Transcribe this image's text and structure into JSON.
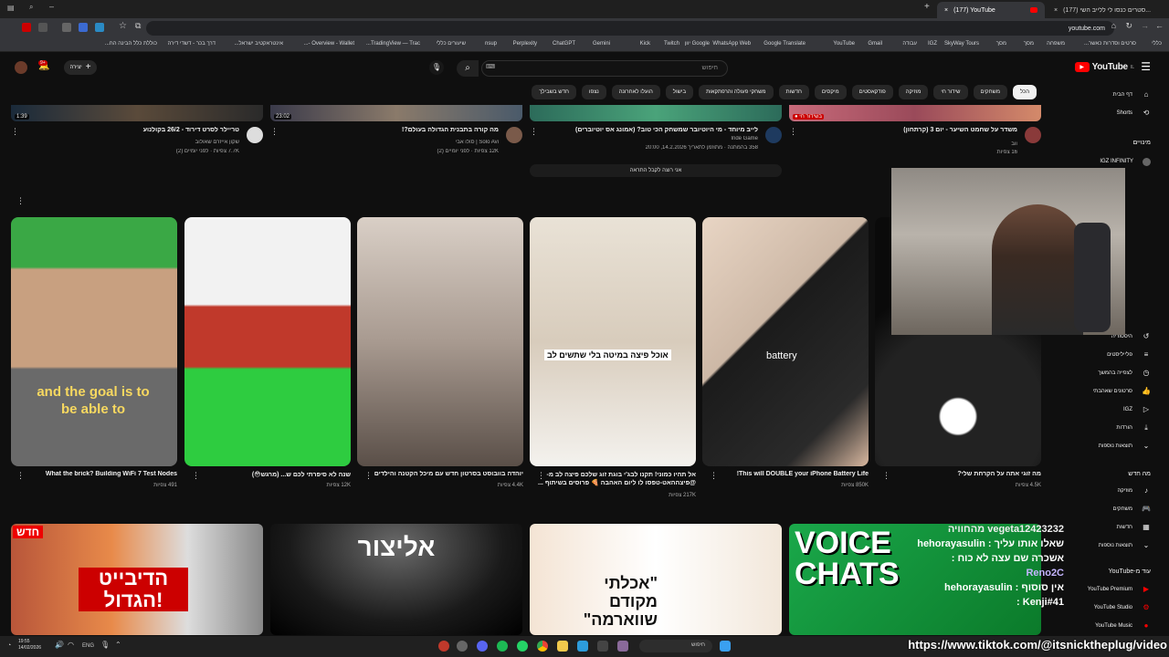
{
  "browser": {
    "tabs": [
      {
        "label": "(177) YouTube",
        "active": true
      },
      {
        "label": "(177) סטרים כנסו לי ללייב השי...",
        "active": false
      }
    ],
    "url": "youtube.com",
    "bookmarks": [
      "כללי",
      "סרטים וסדרות כאשר...",
      "משפחה",
      "מסך",
      "מסך",
      "SkyWay Tours",
      "IGZ",
      "עבודה",
      "Gmail",
      "YouTube",
      "Google Translate",
      "WhatsApp Web",
      "Google יוון",
      "Twitch",
      "Kick",
      "Gemini",
      "ChatGPT",
      "Perplexity",
      "nsup",
      "שיעורים כללי",
      "TradingView — Trac...",
      "Overview - Wallet -...",
      "אינטראקטיב ישראל...",
      "דרך בכר - דשדי דירה",
      "כוללת כלל הבינה הח..."
    ]
  },
  "youtube": {
    "logo_text": "YouTube",
    "logo_sup": "IL",
    "search_placeholder": "חיפוש",
    "create_label": "יצירה",
    "notif_count": "9+",
    "chips": [
      "הכל",
      "משחקים",
      "שידור חי",
      "מוזיקה",
      "פודקאסטים",
      "מיקסים",
      "חדשות",
      "משחקי פעולה והרפתקאות",
      "בישול",
      "הועלו לאחרונה",
      "נצפו",
      "חדש בשבילך"
    ]
  },
  "sidebar": {
    "items": [
      {
        "label": "דף הבית",
        "icon": "home-icon"
      },
      {
        "label": "Shorts",
        "icon": "shorts-icon"
      }
    ],
    "subs_header": "מינויים",
    "subs": [
      {
        "label": "IGZ INFINITY"
      }
    ],
    "you_items": [
      {
        "label": "היסטוריה",
        "icon": "history-icon"
      },
      {
        "label": "פלייליסטים",
        "icon": "playlist-icon"
      },
      {
        "label": "לצפייה בהמשך",
        "icon": "clock-icon"
      },
      {
        "label": "סרטונים שאהבתי",
        "icon": "like-icon"
      },
      {
        "label": "IGZ",
        "icon": "video-icon"
      },
      {
        "label": "הורדות",
        "icon": "download-icon"
      },
      {
        "label": "תוצאות נוספות",
        "icon": "chevron-down-icon"
      }
    ],
    "explore_header": "מה חדש",
    "explore": [
      {
        "label": "מוזיקה",
        "icon": "music-icon"
      },
      {
        "label": "משחקים",
        "icon": "game-icon"
      },
      {
        "label": "חדשות",
        "icon": "news-icon"
      },
      {
        "label": "תוצאות נוספות",
        "icon": "chevron-down-icon"
      }
    ],
    "more_header": "עוד מ-YouTube",
    "more": [
      {
        "label": "YouTube Premium"
      },
      {
        "label": "YouTube Studio"
      },
      {
        "label": "YouTube Music"
      }
    ]
  },
  "row1": [
    {
      "title": "משדר על שחמט השיער - יום 3 (קרתחון)",
      "channel": "ווב",
      "meta": "16 צפיות",
      "duration": "",
      "badge": "● בשידור חי"
    },
    {
      "title": "לייב מיוחד - מי היוטיובר שמשחק הכי טוב? (אמונג אס יוטיוברים)",
      "channel": "Inde Game",
      "meta": "358 בהמתנה · מתוזמן לתאריך 14.2.2026, 20:00",
      "duration": "",
      "badge": ""
    },
    {
      "title": "מה קורה בתבנית הגדולה בעולם?!",
      "channel": "Solo Avi | סולו אבי",
      "meta": "12K צפיות · לפני יומיים (2)",
      "duration": "23:02",
      "badge": ""
    },
    {
      "title": "טריילר לסרט דירוד - 26/2 בקולנוע",
      "channel": "שקון אייזרם שאולוב",
      "meta": "7.7K צפיות · לפני יומיים (2)",
      "duration": "1:39",
      "badge": ""
    }
  ],
  "shorts_notice": "אני רוצה לקבל התראה",
  "shorts": [
    {
      "title": "מה זוגי אתה על הקרחת שלי?",
      "views": "4.5K צפיות"
    },
    {
      "title": "This will DOUBLE your iPhone Battery Life!",
      "views": "850K צפיות",
      "caption": "battery"
    },
    {
      "title": "אל תהיו כמוני! תקנו לבג'י בוגת זוג שלכם פיצה לב מ-@פיצההאט-טפסו לו ליום האהבה 🍕 פרוסים בשיתוף ...",
      "views": "217K צפיות",
      "caption": "אוכל פיצה במיטה בלי שתשים לב"
    },
    {
      "title": "יוהדה בוובוסט בסרטון חדש עם מיכל הקטנה והילדים",
      "views": "4.4K צפיות"
    },
    {
      "title": "שנה לא סיפרתי לכם ש... (מרגש😳)",
      "views": "12K צפיות"
    },
    {
      "title": "What the brick? Building WiFi 7 Test Nodes",
      "views": "491 צפיות",
      "caption": "and the goal is to be able to"
    }
  ],
  "row3": [
    {
      "label": "VOICE CHATS"
    },
    {
      "label": "\"אכלתי מקודם שווארמה\""
    },
    {
      "label": "אליצור"
    },
    {
      "label": "הדיבייט הגדול!",
      "badge": "חדש"
    }
  ],
  "overlay": {
    "chat": [
      "vegeta12423232 מהחוויה",
      "שאלו אותו עליך : hehorayasulin",
      "אשכרה שם עצה לא כוח :",
      "Reno2C",
      "אין סוסוף : hehorayasulin",
      "Kenji#41 :"
    ],
    "tiktok": "https://www.tiktok.com/@itsnicktheplug/video"
  },
  "taskbar": {
    "time": "19:55",
    "date": "14/02/2026",
    "lang": "ENG",
    "search_label": "חיפוש"
  }
}
